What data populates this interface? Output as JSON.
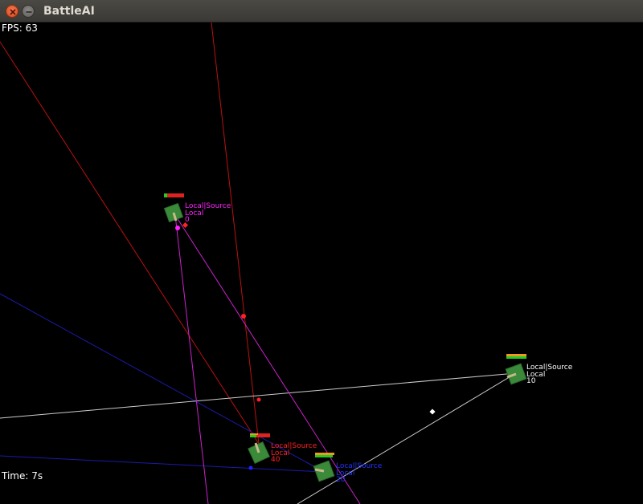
{
  "window": {
    "title": "BattleAI",
    "close_icon": "close-icon",
    "minimize_icon": "minimize-icon"
  },
  "hud": {
    "fps_label": "FPS: 63",
    "time_label": "Time: 7s"
  },
  "colors": {
    "background": "#000000",
    "magenta_team": "#ff22ff",
    "red_team": "#ff2222",
    "blue_team": "#2222ff",
    "white_team": "#ffffff",
    "tank_body": "#3a8a3a",
    "tank_barrel": "#c8b98a",
    "health_green": "#22cc22",
    "health_red": "#dd2222",
    "health_orange": "#ee9922"
  },
  "units": [
    {
      "id": "magenta",
      "color": "#ff22ff",
      "name_line": "Local|Source",
      "type_line": "Local",
      "score": "0"
    },
    {
      "id": "red",
      "color": "#ff2222",
      "name_line": "Local|Source",
      "type_line": "Local",
      "score": "40"
    },
    {
      "id": "blue",
      "color": "#2222ff",
      "name_line": "Local|Source",
      "type_line": "Local",
      "score": "20"
    },
    {
      "id": "white",
      "color": "#ffffff",
      "name_line": "Local|Source",
      "type_line": "Local",
      "score": "10"
    }
  ]
}
